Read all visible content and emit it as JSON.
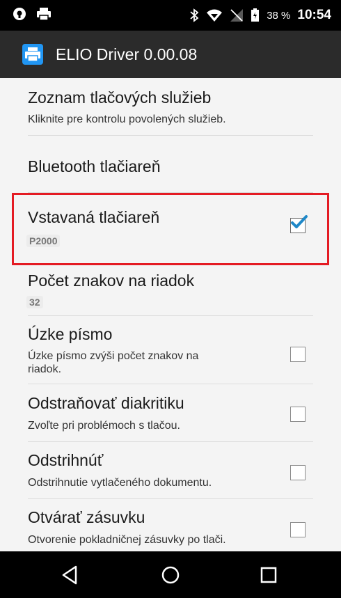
{
  "status_bar": {
    "battery_percent": "38 %",
    "time": "10:54",
    "left_icons": [
      "vpn-key-icon",
      "printer-icon"
    ],
    "right_icons": [
      "bluetooth-icon",
      "wifi-icon",
      "signal-icon",
      "battery-icon"
    ]
  },
  "app_bar": {
    "title": "ELIO Driver 0.00.08",
    "icon": "printer-icon",
    "color": "#2b2b2b",
    "icon_color": "#2196f3"
  },
  "settings": [
    {
      "title": "Zoznam tlačových služieb",
      "subtitle": "Kliknite pre kontrolu povolených služieb."
    },
    {
      "title": "Bluetooth tlačiareň"
    },
    {
      "title": "Vstavaná tlačiareň",
      "value": "P2000",
      "checked": true,
      "highlighted": true
    },
    {
      "title": "Počet znakov na riadok",
      "value": "32"
    },
    {
      "title": "Úzke písmo",
      "subtitle_line1": "Úzke písmo zvýši počet znakov na",
      "subtitle_line2": "riadok.",
      "checked": false
    },
    {
      "title": "Odstraňovať diakritiku",
      "subtitle": "Zvoľte pri problémoch s tlačou.",
      "checked": false
    },
    {
      "title": "Odstrihnúť",
      "subtitle": "Odstrihnutie vytlačeného dokumentu.",
      "checked": false
    },
    {
      "title": "Otvárať zásuvku",
      "subtitle": "Otvorenie pokladničnej zásuvky po tlači.",
      "checked": false
    }
  ],
  "highlight_color": "#e41b23",
  "checkmark_color": "#1e88c8",
  "nav_bar": {
    "icons": [
      "back-icon",
      "home-icon",
      "recents-icon"
    ]
  }
}
